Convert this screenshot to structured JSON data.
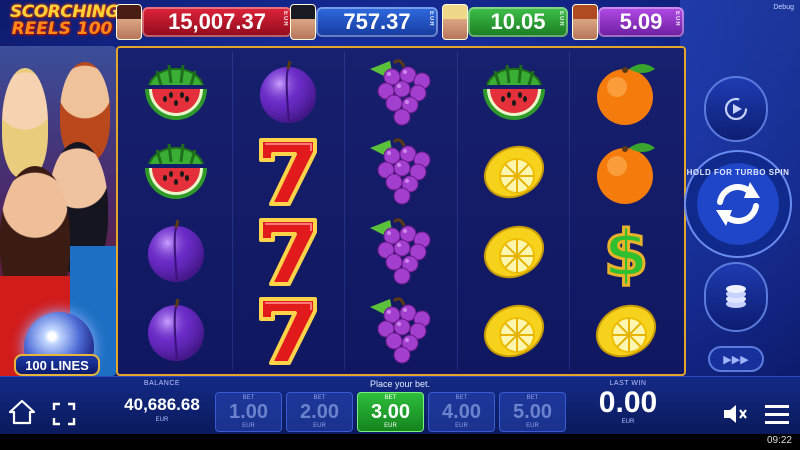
{
  "logo": {
    "line1": "SCORCHING",
    "line2": "REELS 100"
  },
  "jackpots": [
    {
      "value": "15,007.37",
      "currency": "EUR",
      "color": "#c8192e"
    },
    {
      "value": "757.37",
      "currency": "EUR",
      "color": "#2458c9"
    },
    {
      "value": "10.05",
      "currency": "EUR",
      "color": "#2ea63a"
    },
    {
      "value": "5.09",
      "currency": "EUR",
      "color": "#8c30c4"
    }
  ],
  "debug_label": "Debug",
  "lines_badge": "100 LINES",
  "reels": [
    [
      "watermelon-icon",
      "watermelon-icon",
      "plum-icon",
      "plum-icon"
    ],
    [
      "plum-icon",
      "seven-icon",
      "seven-icon",
      "seven-icon"
    ],
    [
      "grapes-icon",
      "grapes-icon",
      "grapes-icon",
      "grapes-icon"
    ],
    [
      "watermelon-icon",
      "lemon-icon",
      "lemon-icon",
      "lemon-icon"
    ],
    [
      "orange-icon",
      "orange-icon",
      "dollar-icon",
      "lemon-icon"
    ]
  ],
  "controls": {
    "turbo_label": "HOLD FOR TURBO SPIN",
    "autoplay_icon": "autoplay-icon",
    "spin_icon": "spin-icon",
    "stake_icon": "coins-icon",
    "ff_icon": "fast-forward-icon"
  },
  "bottom": {
    "balance_label": "BALANCE",
    "balance_value": "40,686.68",
    "balance_currency": "EUR",
    "place_bet": "Place your bet.",
    "bet_label": "BET",
    "bet_currency": "EUR",
    "bets": [
      "1.00",
      "2.00",
      "3.00",
      "4.00",
      "5.00"
    ],
    "active_bet": "3.00",
    "lastwin_label": "LAST WIN",
    "lastwin_value": "0.00",
    "lastwin_currency": "EUR"
  },
  "clock": "09:22"
}
